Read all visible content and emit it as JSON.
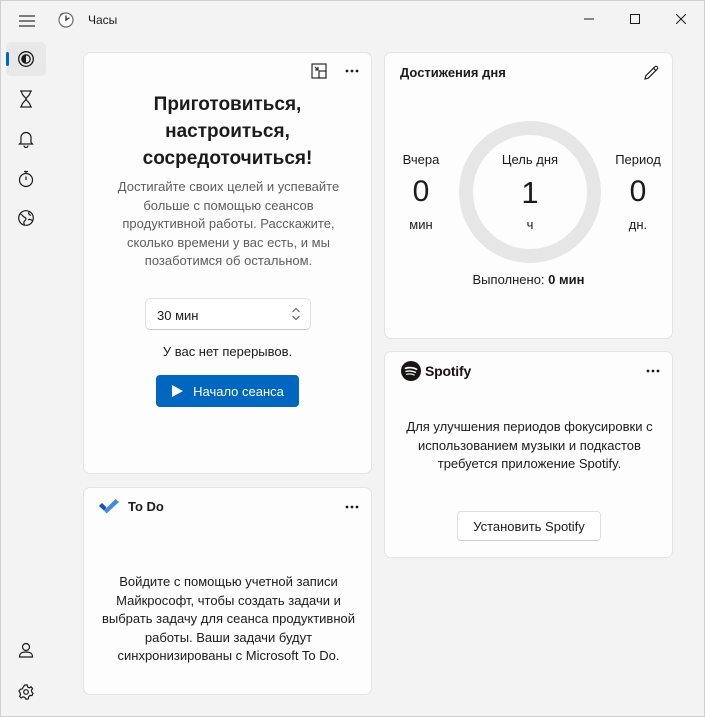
{
  "window": {
    "title": "Часы"
  },
  "sidebar": {
    "items": [
      {
        "icon": "focus-sessions-icon",
        "active": true
      },
      {
        "icon": "timer-icon"
      },
      {
        "icon": "alarm-icon"
      },
      {
        "icon": "stopwatch-icon"
      },
      {
        "icon": "world-clock-icon"
      }
    ],
    "bottom": [
      {
        "icon": "account-icon"
      },
      {
        "icon": "settings-icon"
      }
    ]
  },
  "focus": {
    "title_lines": [
      "Приготовиться,",
      "настроиться,",
      "сосредоточиться!"
    ],
    "description": "Достигайте своих целей и успевайте больше с помощью сеансов продуктивной работы. Расскажите, сколько времени у вас есть, и мы позаботимся об остальном.",
    "duration_value": "30",
    "duration_unit": "мин",
    "breaks_text": "У вас нет перерывов.",
    "start_label": "Начало сеанса"
  },
  "daily_progress": {
    "header": "Достижения дня",
    "yesterday": {
      "label": "Вчера",
      "value": "0",
      "unit": "мин"
    },
    "goal": {
      "label": "Цель дня",
      "value": "1",
      "unit": "ч"
    },
    "streak": {
      "label": "Период",
      "value": "0",
      "unit": "дн."
    },
    "completed_label": "Выполнено:",
    "completed_value": "0 мин",
    "progress_fraction": 0
  },
  "spotify": {
    "brand": "Spotify",
    "description": "Для улучшения периодов фокусировки с использованием музыки и подкастов требуется приложение Spotify.",
    "install_label": "Установить Spotify"
  },
  "todo": {
    "title": "To Do",
    "description": "Войдите с помощью учетной записи Майкрософт, чтобы создать задачи и выбрать задачу для сеанса продуктивной работы. Ваши задачи будут синхронизированы с Microsoft To Do."
  },
  "colors": {
    "accent": "#0067c0",
    "ring_track": "#e6e6e6",
    "todo_blue": "#2564cf"
  }
}
